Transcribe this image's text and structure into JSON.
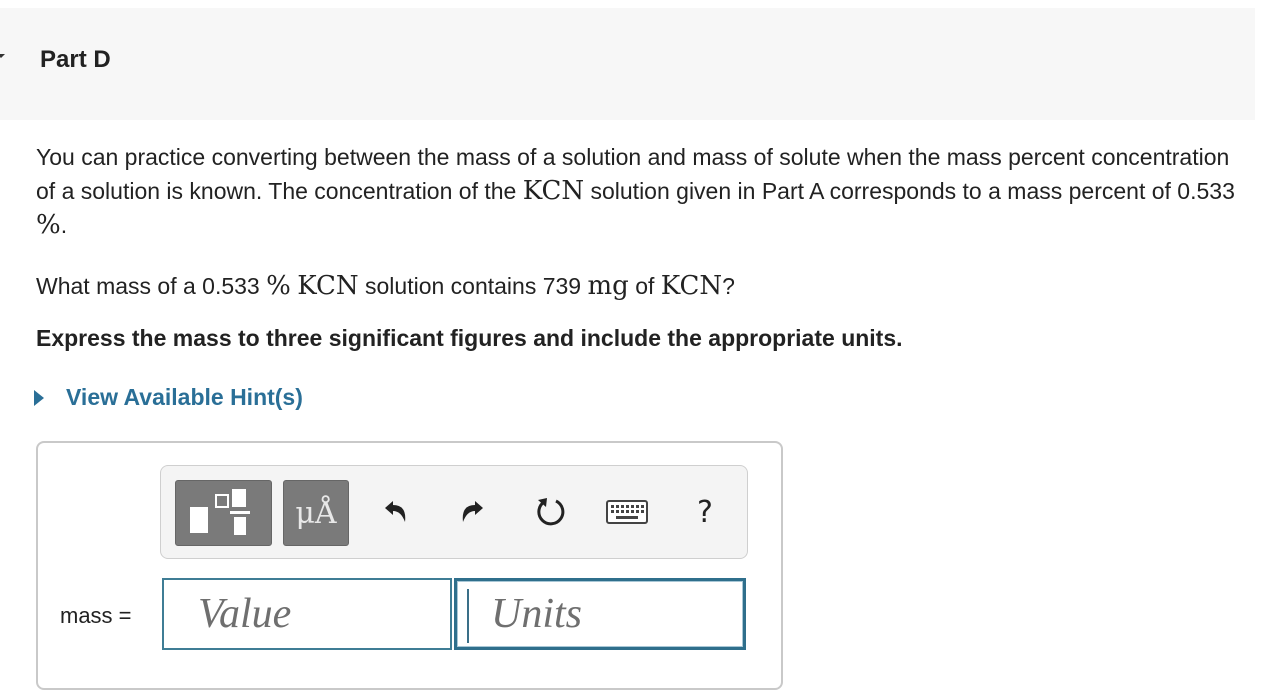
{
  "part": {
    "title": "Part D"
  },
  "prompt": {
    "seg1": "You can practice converting between the mass of a solution and mass of solute when the mass percent concentration of a solution is known. The concentration of the ",
    "kcn1": "KCN",
    "seg2": " solution given in Part A corresponds to a mass percent of 0.533 ",
    "pct1": "%",
    "seg3": "."
  },
  "question": {
    "seg1": "What mass of a 0.533 ",
    "pct": "%",
    "kcn1": "KCN",
    "seg2": " solution contains 739 ",
    "mg": "mg",
    "seg3": " of ",
    "kcn2": "KCN",
    "seg4": "?"
  },
  "instruction": "Express the mass to three significant figures and include the appropriate units.",
  "hint": {
    "label": "View Available Hint(s)"
  },
  "answer": {
    "label": "mass =",
    "value_placeholder": "Value",
    "units_placeholder": "Units"
  },
  "toolbar": {
    "units_button": "μÅ",
    "help": "?",
    "icons": [
      "templates-icon",
      "units-icon",
      "undo-icon",
      "redo-icon",
      "reset-icon",
      "keyboard-icon",
      "help-icon"
    ]
  },
  "colors": {
    "header_bg": "#f7f7f7",
    "link": "#2a6f97",
    "input_border": "#2f6f8c"
  }
}
